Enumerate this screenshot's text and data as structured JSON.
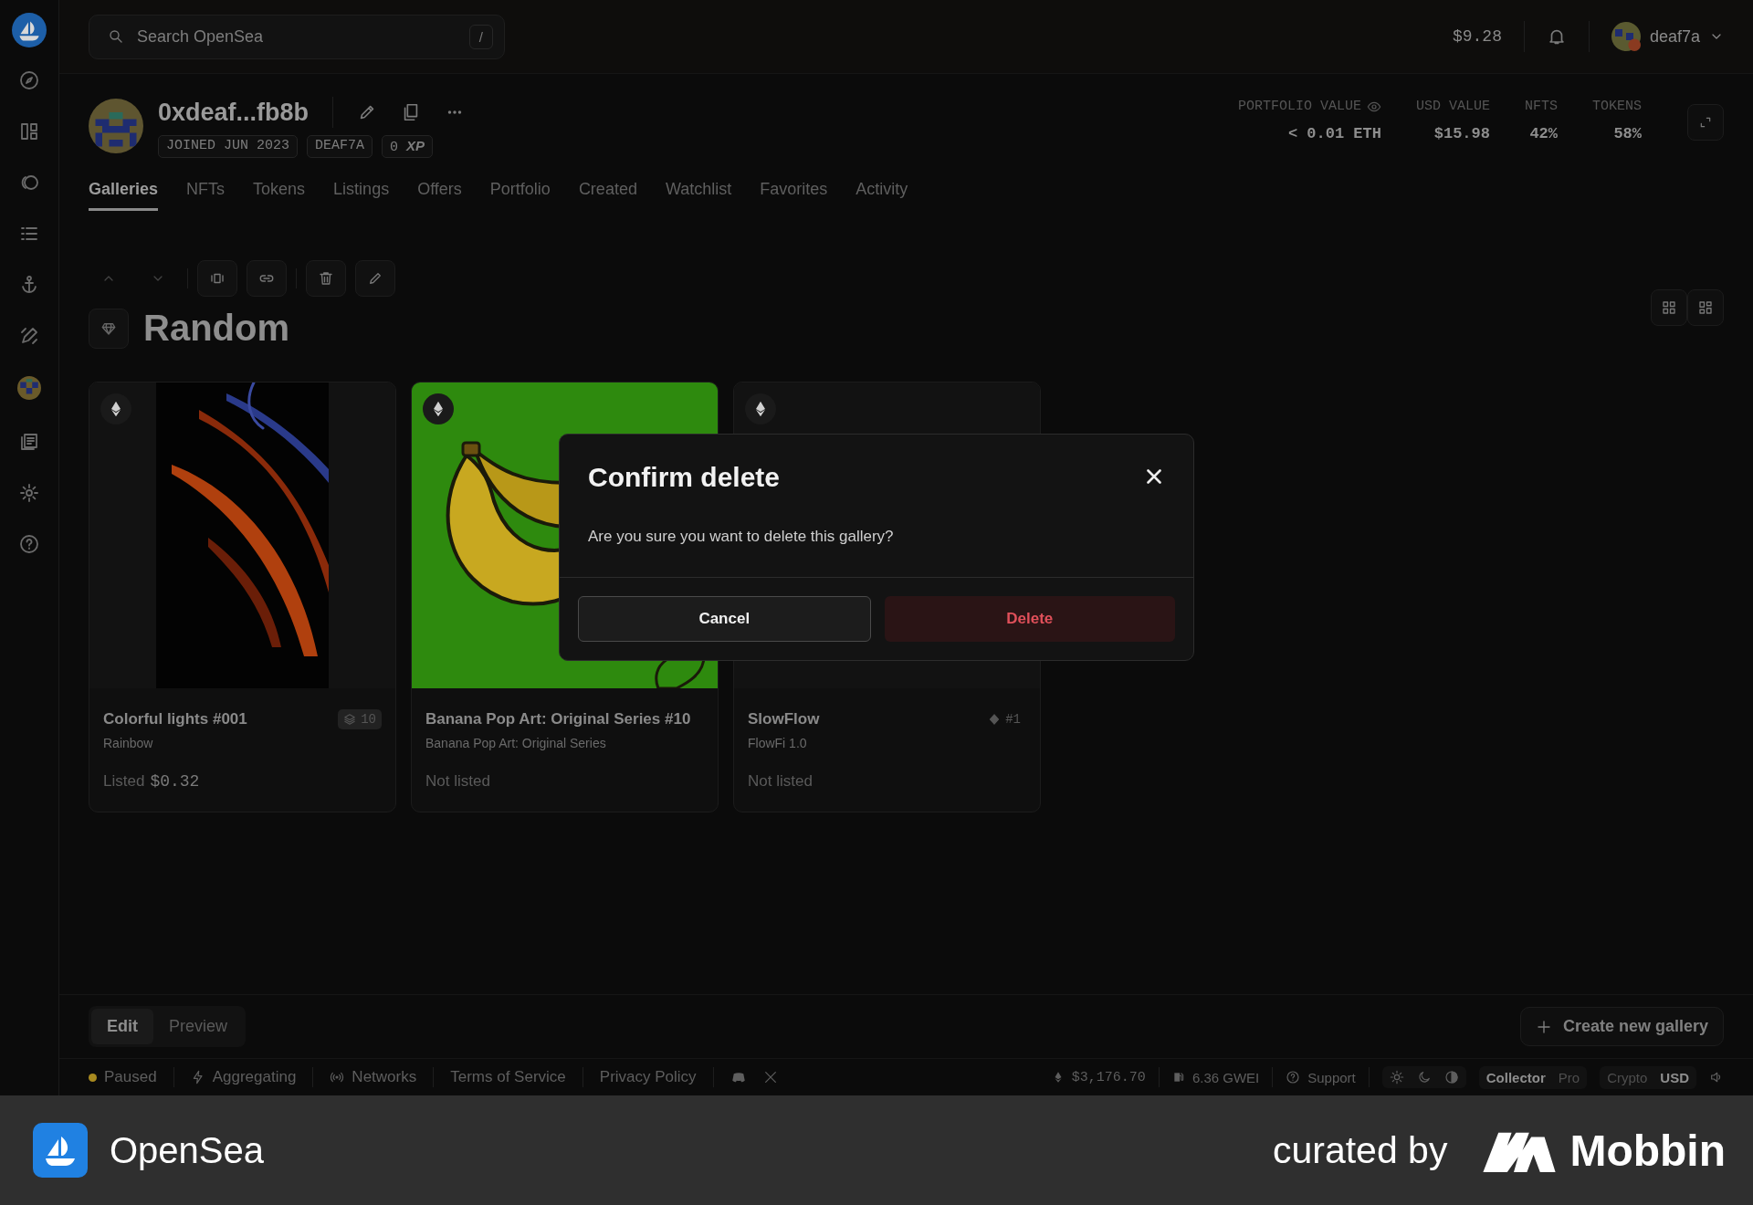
{
  "search": {
    "placeholder": "Search OpenSea",
    "shortcut": "/"
  },
  "top_bar": {
    "balance": "$9.28",
    "username": "deaf7a"
  },
  "profile": {
    "name": "0xdeaf...fb8b",
    "tags": [
      "JOINED JUN 2023",
      "DEAF7A",
      "0 **XP**"
    ]
  },
  "stats": [
    {
      "label": "PORTFOLIO VALUE",
      "value": "< 0.01 ETH"
    },
    {
      "label": "USD VALUE",
      "value": "$15.98"
    },
    {
      "label": "NFTS",
      "value": "42%"
    },
    {
      "label": "TOKENS",
      "value": "58%"
    }
  ],
  "tabs": [
    {
      "label": "Galleries",
      "selected": true
    },
    {
      "label": "NFTs",
      "selected": false
    },
    {
      "label": "Tokens",
      "selected": false
    },
    {
      "label": "Listings",
      "selected": false
    },
    {
      "label": "Offers",
      "selected": false
    },
    {
      "label": "Portfolio",
      "selected": false
    },
    {
      "label": "Created",
      "selected": false
    },
    {
      "label": "Watchlist",
      "selected": false
    },
    {
      "label": "Favorites",
      "selected": false
    },
    {
      "label": "Activity",
      "selected": false
    }
  ],
  "gallery": {
    "title": "Random",
    "items": [
      {
        "name": "Colorful lights #001",
        "collection": "Rainbow",
        "status": "Listed",
        "price": "$0.32",
        "badge": {
          "kind": "stack",
          "text": "10"
        }
      },
      {
        "name": "Banana Pop Art: Original Series #10",
        "collection": "Banana Pop Art: Original Series",
        "status": "Not listed"
      },
      {
        "name": "SlowFlow",
        "collection": "FlowFi 1.0",
        "status": "Not listed",
        "badge": {
          "kind": "rank",
          "text": "#1"
        }
      }
    ]
  },
  "mode_tabs": [
    {
      "label": "Edit",
      "selected": true
    },
    {
      "label": "Preview",
      "selected": false
    }
  ],
  "create_button": "Create new gallery",
  "status_bar": {
    "left": [
      {
        "kind": "dot",
        "label": "Paused"
      },
      {
        "kind": "bolt",
        "label": "Aggregating"
      },
      {
        "kind": "signal",
        "label": "Networks"
      },
      {
        "kind": "link",
        "label": "Terms of Service"
      },
      {
        "kind": "link",
        "label": "Privacy Policy"
      }
    ],
    "eth_price": "$3,176.70",
    "gas": "6.36 GWEI",
    "support": "Support",
    "view_modes": [
      {
        "label": "Collector",
        "selected": true
      },
      {
        "label": "Pro",
        "selected": false
      }
    ],
    "currencies": [
      {
        "label": "Crypto",
        "selected": false
      },
      {
        "label": "USD",
        "selected": true
      }
    ]
  },
  "dialog": {
    "title": "Confirm delete",
    "message": "Are you sure you want to delete this gallery?",
    "buttons": [
      {
        "label": "Cancel",
        "kind": "secondary"
      },
      {
        "label": "Delete",
        "kind": "danger"
      }
    ]
  },
  "banner": {
    "brand": "OpenSea",
    "credit": "curated by",
    "credit_brand": "Mobbin"
  }
}
